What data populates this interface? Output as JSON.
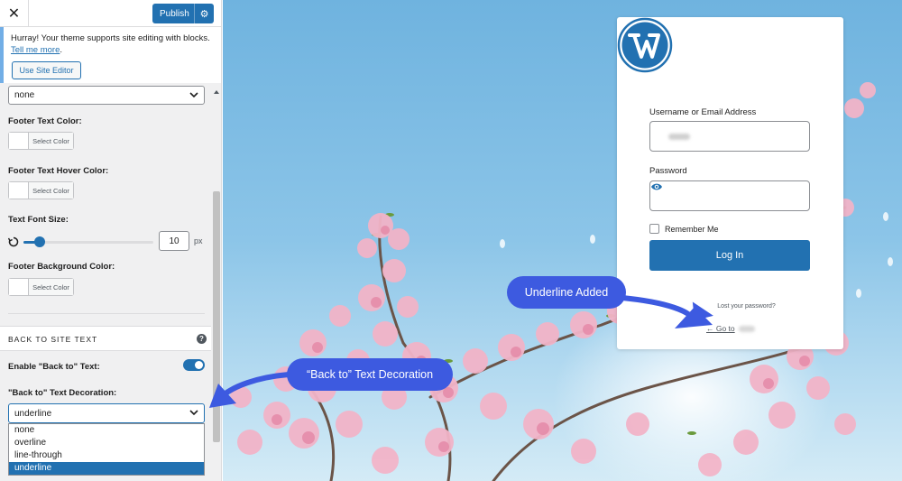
{
  "topbar": {
    "close_icon": "✕",
    "publish_label": "Publish",
    "settings_icon": "⚙"
  },
  "notice": {
    "text": "Hurray! Your theme supports site editing with blocks.",
    "link": "Tell me more",
    "link_suffix": ".",
    "button": "Use Site Editor"
  },
  "controls": {
    "top_select_value": "none",
    "footer_text_color_label": "Footer Text Color:",
    "footer_text_hover_label": "Footer Text Hover Color:",
    "select_color_label": "Select Color",
    "font_size_label": "Text Font Size:",
    "font_size_value": "10",
    "font_size_unit": "px",
    "font_size_level": 10,
    "font_size_max": 100,
    "footer_bg_label": "Footer Background Color:"
  },
  "section": {
    "title": "BACK TO SITE TEXT",
    "help_icon": "?",
    "enable_label": "Enable \"Back to\" Text:",
    "enable_on": true,
    "decoration_label": "\"Back to\" Text Decoration:",
    "decoration_value": "underline",
    "decoration_options": [
      "none",
      "overline",
      "line-through",
      "underline"
    ],
    "decoration_selected_index": 3
  },
  "login": {
    "username_label": "Username or Email Address",
    "password_label": "Password",
    "remember_label": "Remember Me",
    "login_button": "Log In",
    "lost_password": "Lost your password?",
    "go_to": "← Go to"
  },
  "callouts": {
    "underline_added": "Underline Added",
    "decoration": "“Back to” Text Decoration"
  },
  "colors": {
    "accent": "#2271b1",
    "callout": "#3d5ae0",
    "sidebar_bg": "#f0f0f1"
  }
}
